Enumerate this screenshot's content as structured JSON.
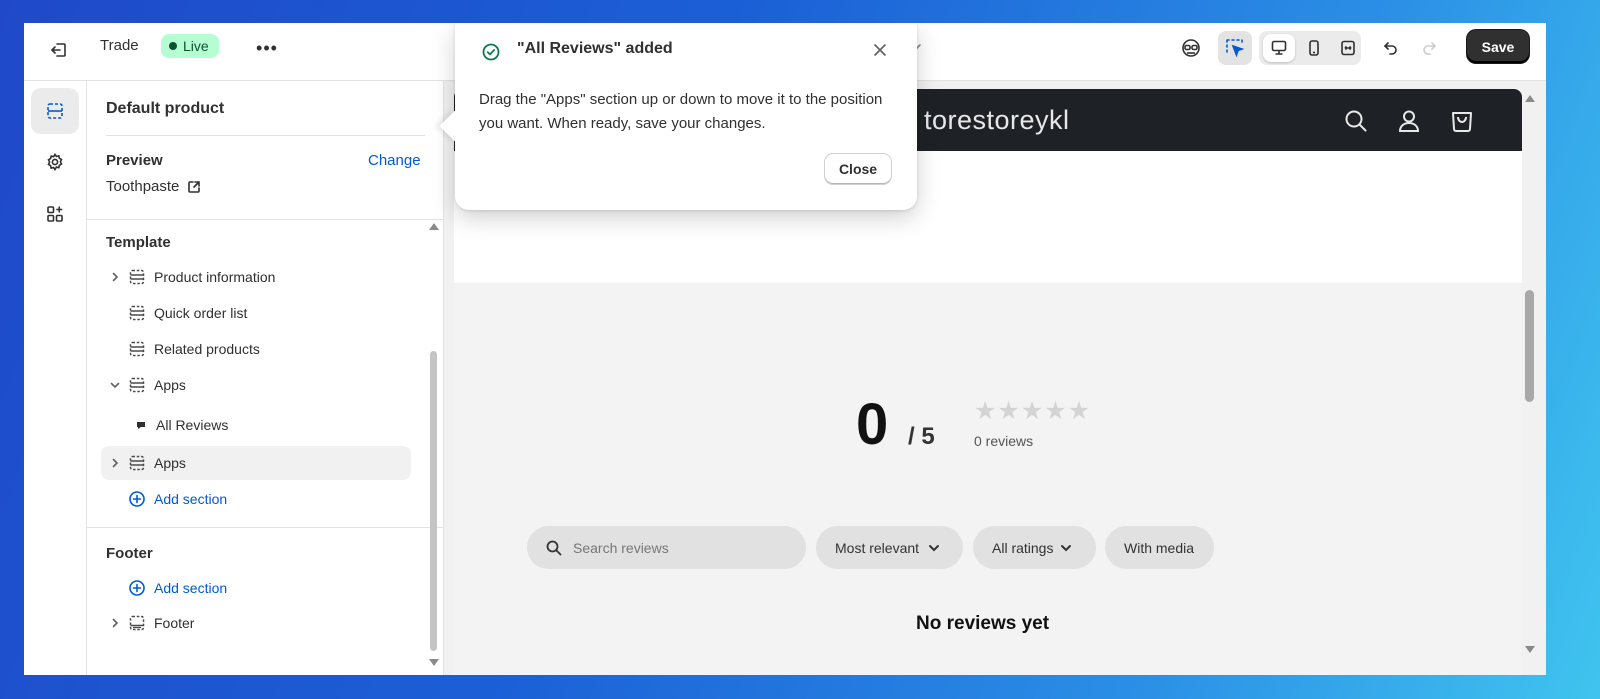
{
  "topbar": {
    "store_name": "Trade",
    "live_label": "Live",
    "more_label": "•••",
    "save_label": "Save"
  },
  "sidebar": {
    "title": "Default product",
    "preview_label": "Preview",
    "change_label": "Change",
    "preview_product": "Toothpaste",
    "template_heading": "Template",
    "template_items": [
      {
        "label": "Product information"
      },
      {
        "label": "Quick order list"
      },
      {
        "label": "Related products"
      },
      {
        "label": "Apps"
      },
      {
        "label": "All Reviews"
      },
      {
        "label": "Apps"
      }
    ],
    "add_section_label": "Add section",
    "footer_heading": "Footer",
    "footer_add_section_label": "Add section",
    "footer_item": "Footer"
  },
  "popover": {
    "title": "\"All Reviews\" added",
    "body": "Drag the \"Apps\" section up or down to move it to the position you want. When ready, save your changes.",
    "close_label": "Close"
  },
  "preview": {
    "store_name": "torestoreykl",
    "score": "0",
    "score_max": "/ 5",
    "rating_stars": 0,
    "review_count": "0 reviews",
    "search_placeholder": "Search reviews",
    "sort_label": "Most relevant",
    "ratings_filter_label": "All ratings",
    "media_filter_label": "With media",
    "empty_message": "No reviews yet"
  },
  "colors": {
    "accent_blue": "#005bd3",
    "live_badge_bg": "#b4fed2",
    "live_badge_text": "#0c5132",
    "save_button_bg": "#303030",
    "store_header_bg": "#1e2226"
  }
}
